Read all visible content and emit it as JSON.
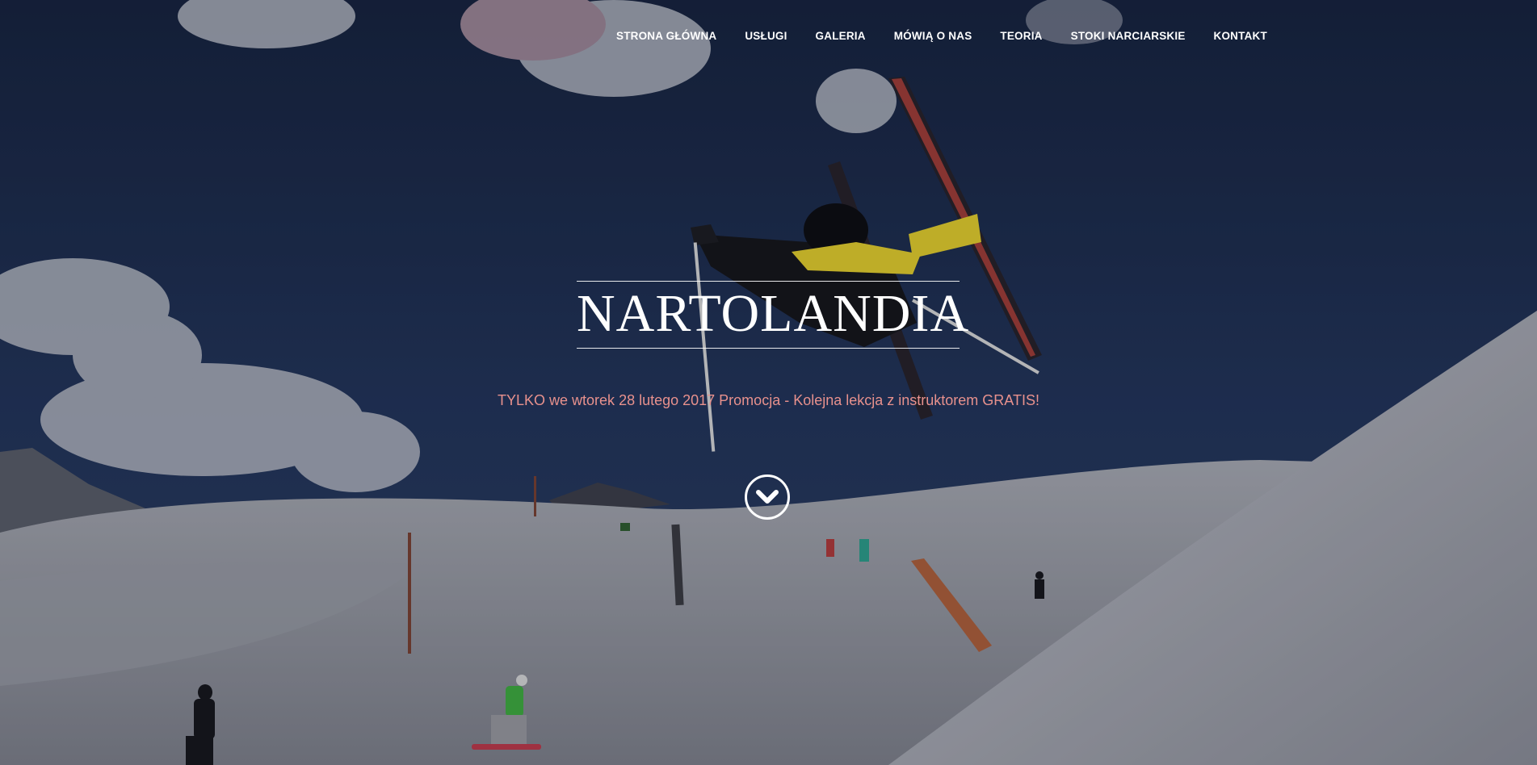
{
  "nav": {
    "items": [
      {
        "label": "STRONA GŁÓWNA"
      },
      {
        "label": "USŁUGI"
      },
      {
        "label": "GALERIA"
      },
      {
        "label": "MÓWIĄ O NAS"
      },
      {
        "label": "TEORIA"
      },
      {
        "label": "STOKI NARCIARSKIE"
      },
      {
        "label": "KONTAKT"
      }
    ]
  },
  "hero": {
    "title": "NARTOLANDIA",
    "promo": "TYLKO we wtorek 28 lutego 2017 Promocja - Kolejna lekcja z instruktorem GRATIS!",
    "scroll_icon": "chevron-down-icon"
  },
  "colors": {
    "nav_text": "#ffffff",
    "title_text": "#ffffff",
    "promo_text": "#e8918d"
  }
}
